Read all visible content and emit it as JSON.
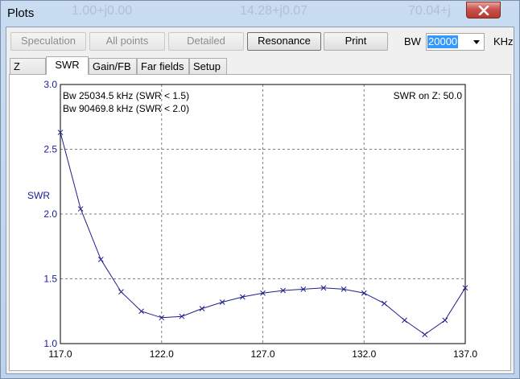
{
  "window": {
    "title": "Plots",
    "background_readouts": [
      "1.00+j0.00",
      "14.28+j0.07",
      "70.04+j"
    ]
  },
  "toolbar": {
    "speculation_label": "Speculation",
    "all_points_label": "All points",
    "detailed_label": "Detailed",
    "resonance_label": "Resonance",
    "print_label": "Print",
    "bw_label": "BW",
    "bw_value": "20000",
    "bw_unit": "KHz"
  },
  "tabs": [
    {
      "label": "Z",
      "selected": false
    },
    {
      "label": "SWR",
      "selected": true
    },
    {
      "label": "Gain/FB",
      "selected": false
    },
    {
      "label": "Far fields",
      "selected": false
    },
    {
      "label": "Setup",
      "selected": false
    }
  ],
  "chart_data": {
    "type": "line",
    "ylabel": "SWR",
    "xlim": [
      117.0,
      137.0
    ],
    "ylim": [
      1.0,
      3.0
    ],
    "x_ticks": [
      "117.0",
      "122.0",
      "127.0",
      "132.0",
      "137.0"
    ],
    "y_ticks": [
      "1.0",
      "1.5",
      "2.0",
      "2.5",
      "3.0"
    ],
    "grid": true,
    "annotations": [
      "Bw 25034.5 kHz (SWR < 1.5)",
      "Bw 90469.8 kHz (SWR < 2.0)"
    ],
    "corner_note": "SWR on Z: 50.0",
    "series": [
      {
        "color": "#1f1f8c",
        "x": [
          117.0,
          118.0,
          119.0,
          120.0,
          121.0,
          122.0,
          123.0,
          124.0,
          125.0,
          126.0,
          127.0,
          128.0,
          129.0,
          130.0,
          131.0,
          132.0,
          133.0,
          134.0,
          135.0,
          136.0,
          137.0
        ],
        "y": [
          2.63,
          2.04,
          1.65,
          1.4,
          1.25,
          1.2,
          1.21,
          1.27,
          1.32,
          1.36,
          1.39,
          1.41,
          1.42,
          1.43,
          1.42,
          1.39,
          1.31,
          1.18,
          1.07,
          1.18,
          1.43
        ]
      }
    ]
  }
}
